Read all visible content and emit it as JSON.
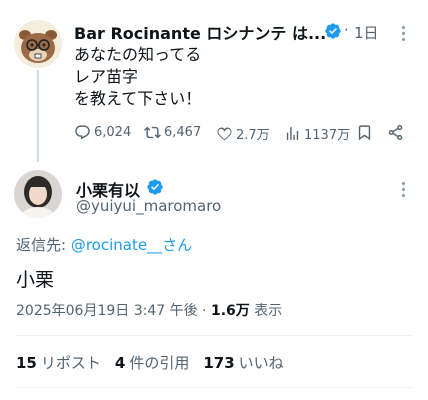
{
  "parent_tweet": {
    "display_name": "Bar Rocinante ロシナンテ は...",
    "separator": "·",
    "time": "1日",
    "text_lines": [
      "あなたの知ってる",
      "レア苗字",
      "を教えて下さい！"
    ],
    "actions": {
      "replies": "6,024",
      "retweets": "6,467",
      "likes": "2.7万",
      "views": "1137万"
    },
    "verified_color": "#1d9bf0"
  },
  "reply_tweet": {
    "display_name": "小栗有以",
    "handle": "@yuiyui_maromaro",
    "reply_to_label": "返信先: ",
    "reply_to_handle": "@rocinate__さん",
    "text": "小栗",
    "timestamp": "2025年06月19日 3:47 午後",
    "meta_separator": " · ",
    "view_count": "1.6万",
    "view_label": " 表示",
    "stats": {
      "retweet_count": "15",
      "retweet_label": "リポスト",
      "quote_count": "4",
      "quote_label": "件の引用",
      "like_count": "173",
      "like_label": "いいね"
    }
  },
  "colors": {
    "text": "#0f1419",
    "secondary": "#536471",
    "accent": "#1d9bf0",
    "divider": "#eff3f4"
  },
  "icons": [
    "reply-icon",
    "retweet-icon",
    "like-icon",
    "views-icon",
    "bookmark-icon",
    "share-icon",
    "more-icon",
    "verified-badge-icon"
  ]
}
